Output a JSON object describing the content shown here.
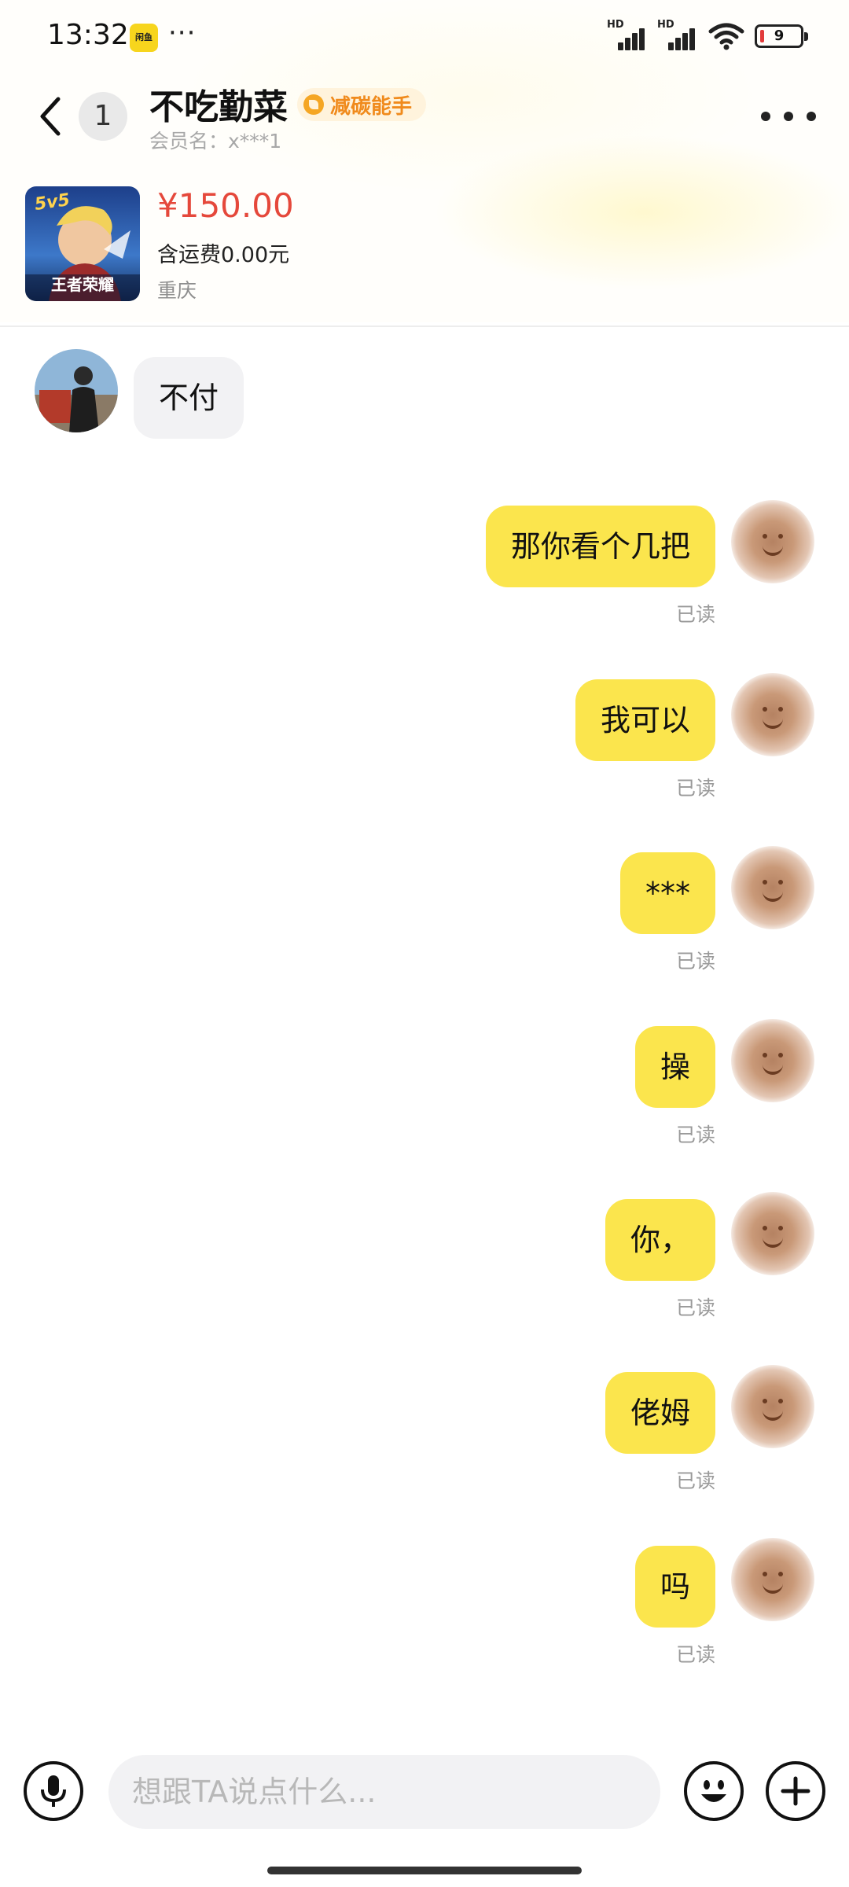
{
  "status_bar": {
    "time": "13:32",
    "app_icon_label": "闲鱼",
    "more": "···",
    "signal_1_label": "HD",
    "signal_2_label": "HD",
    "battery": "9"
  },
  "header": {
    "unread_count": "1",
    "nickname": "不吃勤菜",
    "badge": "减碳能手",
    "member_name": "会员名：x***1"
  },
  "product": {
    "thumb_tag": "5v5",
    "thumb_title": "王者荣耀",
    "price": "¥150.00",
    "shipping": "含运费0.00元",
    "location": "重庆"
  },
  "messages": [
    {
      "sender": "other",
      "text": "不付"
    },
    {
      "sender": "me",
      "text": "那你看个几把",
      "status": "已读"
    },
    {
      "sender": "me",
      "text": "我可以",
      "status": "已读"
    },
    {
      "sender": "me",
      "text": "***",
      "status": "已读"
    },
    {
      "sender": "me",
      "text": "操",
      "status": "已读"
    },
    {
      "sender": "me",
      "text": "你，",
      "status": "已读"
    },
    {
      "sender": "me",
      "text": "佬姆",
      "status": "已读"
    },
    {
      "sender": "me",
      "text": "吗",
      "status": "已读"
    }
  ],
  "input": {
    "placeholder": "想跟TA说点什么...",
    "value": ""
  },
  "icons": {
    "back": "chevron-left-icon",
    "more": "more-dots-icon",
    "mic": "microphone-icon",
    "emoji": "emoji-icon",
    "plus": "plus-icon"
  },
  "colors": {
    "my_bubble": "#fbe54d",
    "other_bubble": "#f2f2f4",
    "price": "#e5483b",
    "badge_text": "#f08a1c",
    "badge_bg": "#fff3dc"
  }
}
